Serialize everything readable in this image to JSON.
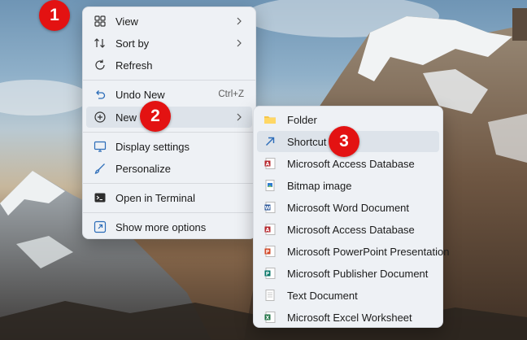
{
  "context_menu": {
    "items": [
      {
        "label": "View",
        "icon": "view-grid-icon",
        "has_submenu": true
      },
      {
        "label": "Sort by",
        "icon": "sort-icon",
        "has_submenu": true
      },
      {
        "label": "Refresh",
        "icon": "refresh-icon"
      },
      {
        "label": "Undo New",
        "icon": "undo-icon",
        "shortcut": "Ctrl+Z"
      },
      {
        "label": "New",
        "icon": "new-plus-icon",
        "has_submenu": true,
        "highlighted": true
      },
      {
        "label": "Display settings",
        "icon": "display-icon"
      },
      {
        "label": "Personalize",
        "icon": "brush-icon"
      },
      {
        "label": "Open in Terminal",
        "icon": "terminal-icon"
      },
      {
        "label": "Show more options",
        "icon": "more-options-icon"
      }
    ]
  },
  "new_submenu": {
    "items": [
      {
        "label": "Folder",
        "icon": "folder-icon"
      },
      {
        "label": "Shortcut",
        "icon": "shortcut-icon",
        "highlighted": true
      },
      {
        "label": "Microsoft Access Database",
        "icon": "access-icon"
      },
      {
        "label": "Bitmap image",
        "icon": "bitmap-icon"
      },
      {
        "label": "Microsoft Word Document",
        "icon": "word-icon"
      },
      {
        "label": "Microsoft Access Database",
        "icon": "access-icon"
      },
      {
        "label": "Microsoft PowerPoint Presentation",
        "icon": "powerpoint-icon"
      },
      {
        "label": "Microsoft Publisher Document",
        "icon": "publisher-icon"
      },
      {
        "label": "Text Document",
        "icon": "text-document-icon"
      },
      {
        "label": "Microsoft Excel Worksheet",
        "icon": "excel-icon"
      }
    ]
  },
  "step_badges": [
    "1",
    "2",
    "3"
  ],
  "colors": {
    "menu_bg": "#eef1f5",
    "highlight": "#dde3ea",
    "badge": "#e31212",
    "accent": "#2b6cb8"
  }
}
